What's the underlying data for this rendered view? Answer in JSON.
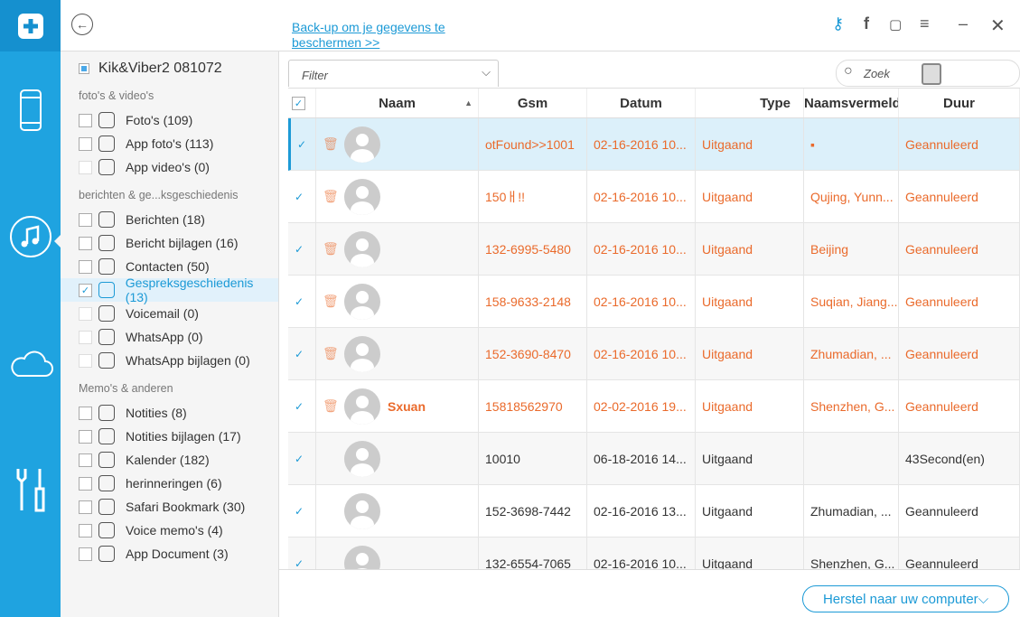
{
  "device": {
    "name": "Kik&Viber2 081072"
  },
  "sidebar": {
    "groups": [
      {
        "title": "foto's & video's",
        "items": [
          {
            "label": "Foto's (109)",
            "icon": "flower-icon",
            "checked": false,
            "disabled": false
          },
          {
            "label": "App foto's (113)",
            "icon": "image-icon",
            "checked": false,
            "disabled": false
          },
          {
            "label": "App video's (0)",
            "icon": "play-icon",
            "checked": false,
            "disabled": true
          }
        ]
      },
      {
        "title": "berichten & ge...ksgeschiedenis",
        "items": [
          {
            "label": "Berichten (18)",
            "icon": "message-icon",
            "checked": false,
            "disabled": false
          },
          {
            "label": "Bericht bijlagen (16)",
            "icon": "paperclip-icon",
            "checked": false,
            "disabled": false
          },
          {
            "label": "Contacten (50)",
            "icon": "contacts-icon",
            "checked": false,
            "disabled": false
          },
          {
            "label": "Gespreksgeschiedenis (13)",
            "icon": "phone-icon",
            "checked": true,
            "disabled": false,
            "active": true
          },
          {
            "label": "Voicemail (0)",
            "icon": "microphone-icon",
            "checked": false,
            "disabled": true
          },
          {
            "label": "WhatsApp (0)",
            "icon": "whatsapp-icon",
            "checked": false,
            "disabled": true
          },
          {
            "label": "WhatsApp bijlagen (0)",
            "icon": "paperclip-icon",
            "checked": false,
            "disabled": true
          }
        ]
      },
      {
        "title": "Memo's & anderen",
        "items": [
          {
            "label": "Notities (8)",
            "icon": "notes-icon",
            "checked": false,
            "disabled": false
          },
          {
            "label": "Notities bijlagen (17)",
            "icon": "paperclip-icon",
            "checked": false,
            "disabled": false
          },
          {
            "label": "Kalender (182)",
            "icon": "calendar-icon",
            "checked": false,
            "disabled": false
          },
          {
            "label": "herinneringen (6)",
            "icon": "list-icon",
            "checked": false,
            "disabled": false
          },
          {
            "label": "Safari Bookmark (30)",
            "icon": "compass-icon",
            "checked": false,
            "disabled": false
          },
          {
            "label": "Voice memo's (4)",
            "icon": "waveform-icon",
            "checked": false,
            "disabled": false
          },
          {
            "label": "App Document (3)",
            "icon": "folder-icon",
            "checked": false,
            "disabled": false
          }
        ]
      }
    ]
  },
  "header": {
    "backup_link": "Back-up om je gegevens te beschermen >>"
  },
  "toolbar": {
    "filter_placeholder": "Filter",
    "search_placeholder": "Zoek"
  },
  "table": {
    "columns": [
      "Naam",
      "Gsm",
      "Datum",
      "Type",
      "Naamsvermelding",
      "Duur"
    ],
    "rows": [
      {
        "name": "",
        "gsm": "otFound>>1001",
        "datum": "02-16-2016 10...",
        "type": "Uitgaand",
        "naam": "▪",
        "duur": "Geannuleerd",
        "deleted": true
      },
      {
        "name": "",
        "gsm": "150ㅐ!!",
        "datum": "02-16-2016 10...",
        "type": "Uitgaand",
        "naam": "Qujing, Yunn...",
        "duur": "Geannuleerd",
        "deleted": true
      },
      {
        "name": "",
        "gsm": "132-6995-5480",
        "datum": "02-16-2016 10...",
        "type": "Uitgaand",
        "naam": "Beijing",
        "duur": "Geannuleerd",
        "deleted": true
      },
      {
        "name": "",
        "gsm": "158-9633-2148",
        "datum": "02-16-2016 10...",
        "type": "Uitgaand",
        "naam": "Suqian, Jiang...",
        "duur": "Geannuleerd",
        "deleted": true
      },
      {
        "name": "",
        "gsm": "152-3690-8470",
        "datum": "02-16-2016 10...",
        "type": "Uitgaand",
        "naam": "Zhumadian, ...",
        "duur": "Geannuleerd",
        "deleted": true
      },
      {
        "name": "Sxuan",
        "gsm": "15818562970",
        "datum": "02-02-2016 19...",
        "type": "Uitgaand",
        "naam": "Shenzhen, G...",
        "duur": "Geannuleerd",
        "deleted": true
      },
      {
        "name": "",
        "gsm": "10010",
        "datum": "06-18-2016 14...",
        "type": "Uitgaand",
        "naam": "",
        "duur": "43Second(en)",
        "deleted": false
      },
      {
        "name": "",
        "gsm": "152-3698-7442",
        "datum": "02-16-2016 13...",
        "type": "Uitgaand",
        "naam": "Zhumadian, ...",
        "duur": "Geannuleerd",
        "deleted": false
      },
      {
        "name": "",
        "gsm": "132-6554-7065",
        "datum": "02-16-2016 10...",
        "type": "Uitgaand",
        "naam": "Shenzhen, G...",
        "duur": "Geannuleerd",
        "deleted": false
      }
    ]
  },
  "footer": {
    "restore_label": "Herstel naar uw computer"
  },
  "colors": {
    "accent": "#1c9ad6",
    "deleted": "#ea6a2b",
    "rail": "#1fa3e0"
  }
}
